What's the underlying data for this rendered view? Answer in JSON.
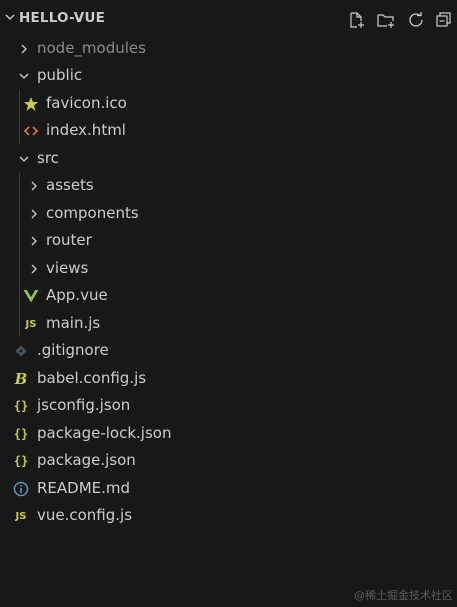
{
  "explorer": {
    "title": "HELLO-VUE",
    "actions": [
      {
        "name": "new-file-icon"
      },
      {
        "name": "new-folder-icon"
      },
      {
        "name": "refresh-icon"
      },
      {
        "name": "collapse-all-icon"
      }
    ]
  },
  "tree": [
    {
      "label": "node_modules",
      "type": "folder",
      "expanded": false,
      "icon": "chevron-right-icon",
      "dimmed": true
    },
    {
      "label": "public",
      "type": "folder",
      "expanded": true,
      "icon": "chevron-down-icon"
    },
    {
      "label": "favicon.ico",
      "type": "file",
      "icon": "star-icon"
    },
    {
      "label": "index.html",
      "type": "file",
      "icon": "html-icon"
    },
    {
      "label": "src",
      "type": "folder",
      "expanded": true,
      "icon": "chevron-down-icon"
    },
    {
      "label": "assets",
      "type": "folder",
      "expanded": false,
      "icon": "chevron-right-icon"
    },
    {
      "label": "components",
      "type": "folder",
      "expanded": false,
      "icon": "chevron-right-icon"
    },
    {
      "label": "router",
      "type": "folder",
      "expanded": false,
      "icon": "chevron-right-icon"
    },
    {
      "label": "views",
      "type": "folder",
      "expanded": false,
      "icon": "chevron-right-icon"
    },
    {
      "label": "App.vue",
      "type": "file",
      "icon": "vue-icon"
    },
    {
      "label": "main.js",
      "type": "file",
      "icon": "js-icon",
      "icon_text": "JS"
    },
    {
      "label": ".gitignore",
      "type": "file",
      "icon": "git-icon"
    },
    {
      "label": "babel.config.js",
      "type": "file",
      "icon": "babel-icon"
    },
    {
      "label": "jsconfig.json",
      "type": "file",
      "icon": "json-icon",
      "icon_text": "{}"
    },
    {
      "label": "package-lock.json",
      "type": "file",
      "icon": "json-icon",
      "icon_text": "{}"
    },
    {
      "label": "package.json",
      "type": "file",
      "icon": "json-icon",
      "icon_text": "{}"
    },
    {
      "label": "README.md",
      "type": "file",
      "icon": "info-icon"
    },
    {
      "label": "vue.config.js",
      "type": "file",
      "icon": "js-icon",
      "icon_text": "JS"
    }
  ],
  "watermark": "@稀土掘金技术社区",
  "colors": {
    "background": "#181818",
    "text": "#cccccc",
    "js": "#cbcb41",
    "json": "#cbcb41",
    "vue": "#8dc149",
    "html": "#e37933",
    "info": "#519aba",
    "git": "#41535b",
    "star": "#cbcb41"
  }
}
